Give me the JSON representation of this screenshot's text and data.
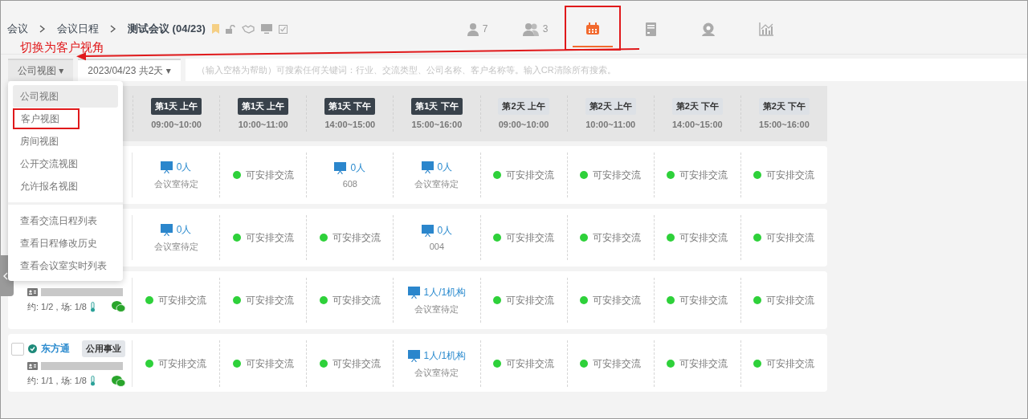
{
  "breadcrumb": [
    {
      "label": "会议",
      "current": false
    },
    {
      "label": "会议日程",
      "current": false
    },
    {
      "label": "测试会议 (04/23)",
      "current": true
    }
  ],
  "nav_tabs": [
    {
      "kind": "person",
      "count": "7",
      "selected": false,
      "highlighted": false
    },
    {
      "kind": "group",
      "count": "3",
      "selected": false,
      "highlighted": false
    },
    {
      "kind": "calendar",
      "selected": true,
      "highlighted": true
    },
    {
      "kind": "document",
      "selected": false,
      "highlighted": false
    },
    {
      "kind": "pin",
      "selected": false,
      "highlighted": false
    },
    {
      "kind": "chart",
      "selected": false,
      "highlighted": false
    }
  ],
  "annotation": {
    "text": "切换为客户视角"
  },
  "toolbar": {
    "view_button": "公司视图 ▾",
    "date_button": "2023/04/23 共2天 ▾",
    "search": {
      "placeholder": "（输入空格为帮助）可搜索任何关键词：行业、交流类型、公司名称、客户名称等。输入CR清除所有搜索。"
    }
  },
  "view_menu": {
    "groups": [
      [
        {
          "label": "公司视图",
          "selected": true,
          "highlighted": false
        },
        {
          "label": "客户视图",
          "selected": false,
          "highlighted": true
        },
        {
          "label": "房间视图",
          "selected": false,
          "highlighted": false
        },
        {
          "label": "公开交流视图",
          "selected": false,
          "highlighted": false
        },
        {
          "label": "允许报名视图",
          "selected": false,
          "highlighted": false
        }
      ],
      [
        {
          "label": "查看交流日程列表",
          "selected": false,
          "highlighted": false
        },
        {
          "label": "查看日程修改历史",
          "selected": false,
          "highlighted": false
        },
        {
          "label": "查看会议室实时列表",
          "selected": false,
          "highlighted": false
        }
      ]
    ]
  },
  "table": {
    "columns": [
      {
        "day": "第1天 上午",
        "time": "09:00~10:00",
        "current": true
      },
      {
        "day": "第1天 上午",
        "time": "10:00~11:00",
        "current": true
      },
      {
        "day": "第1天 下午",
        "time": "14:00~15:00",
        "current": true
      },
      {
        "day": "第1天 下午",
        "time": "15:00~16:00",
        "current": true
      },
      {
        "day": "第2天 上午",
        "time": "09:00~10:00",
        "current": false
      },
      {
        "day": "第2天 上午",
        "time": "10:00~11:00",
        "current": false
      },
      {
        "day": "第2天 下午",
        "time": "14:00~15:00",
        "current": false
      },
      {
        "day": "第2天 下午",
        "time": "15:00~16:00",
        "current": false
      }
    ],
    "rows": [
      {
        "slots": [
          {
            "kind": "meeting",
            "count": "0人",
            "room": "会议室待定"
          },
          {
            "kind": "available",
            "text": "可安排交流"
          },
          {
            "kind": "meeting",
            "count": "0人",
            "room": "608"
          },
          {
            "kind": "meeting",
            "count": "0人",
            "room": "会议室待定"
          },
          {
            "kind": "available",
            "text": "可安排交流"
          },
          {
            "kind": "available",
            "text": "可安排交流"
          },
          {
            "kind": "available",
            "text": "可安排交流"
          },
          {
            "kind": "available",
            "text": "可安排交流"
          }
        ]
      },
      {
        "slots": [
          {
            "kind": "meeting",
            "count": "0人",
            "room": "会议室待定"
          },
          {
            "kind": "available",
            "text": "可安排交流"
          },
          {
            "kind": "available",
            "text": "可安排交流"
          },
          {
            "kind": "meeting",
            "count": "0人",
            "room": "004"
          },
          {
            "kind": "available",
            "text": "可安排交流"
          },
          {
            "kind": "available",
            "text": "可安排交流"
          },
          {
            "kind": "available",
            "text": "可安排交流"
          },
          {
            "kind": "available",
            "text": "可安排交流"
          }
        ]
      },
      {
        "company": {
          "meta": "约: 1/2 , 场: 1/8"
        },
        "slots": [
          {
            "kind": "available",
            "text": "可安排交流"
          },
          {
            "kind": "available",
            "text": "可安排交流"
          },
          {
            "kind": "available",
            "text": "可安排交流"
          },
          {
            "kind": "meeting",
            "count": "1人/1机构",
            "room": "会议室待定"
          },
          {
            "kind": "available",
            "text": "可安排交流"
          },
          {
            "kind": "available",
            "text": "可安排交流"
          },
          {
            "kind": "available",
            "text": "可安排交流"
          },
          {
            "kind": "available",
            "text": "可安排交流"
          }
        ]
      },
      {
        "company": {
          "name": "东方通",
          "tag": "公用事业",
          "checked": false,
          "meta": "约: 1/1 , 场: 1/8"
        },
        "slots": [
          {
            "kind": "available",
            "text": "可安排交流"
          },
          {
            "kind": "available",
            "text": "可安排交流"
          },
          {
            "kind": "available",
            "text": "可安排交流"
          },
          {
            "kind": "meeting",
            "count": "1人/1机构",
            "room": "会议室待定"
          },
          {
            "kind": "available",
            "text": "可安排交流"
          },
          {
            "kind": "available",
            "text": "可安排交流"
          },
          {
            "kind": "available",
            "text": "可安排交流"
          },
          {
            "kind": "available",
            "text": "可安排交流"
          }
        ]
      }
    ]
  }
}
